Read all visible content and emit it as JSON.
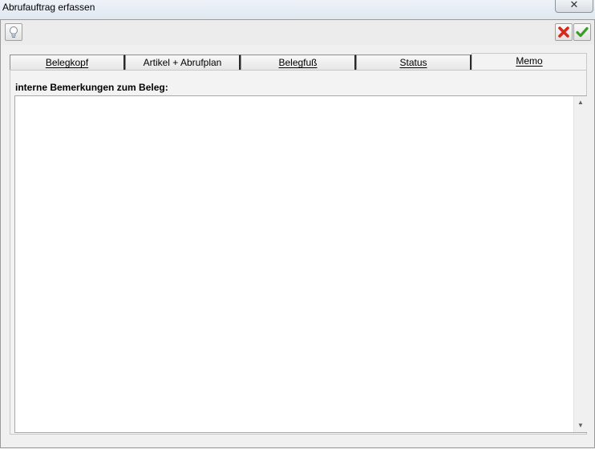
{
  "window": {
    "title": "Abrufauftrag erfassen",
    "close_symbol": "✕"
  },
  "toolbar": {
    "hint_icon": "lightbulb-icon",
    "cancel_icon": "red-x-icon",
    "ok_icon": "green-check-icon"
  },
  "tabs": [
    {
      "label": "Belegkopf",
      "active": false
    },
    {
      "label": "Artikel + Abrufplan",
      "active": false
    },
    {
      "label": "Belegfuß",
      "active": false
    },
    {
      "label": "Status",
      "active": false
    },
    {
      "label": "Memo",
      "active": true
    }
  ],
  "memo": {
    "label": "interne Bemerkungen zum Beleg:",
    "value": ""
  },
  "scrollbar": {
    "up_symbol": "▲",
    "down_symbol": "▼"
  },
  "colors": {
    "cancel_red": "#d8281e",
    "ok_green": "#3a9b2a"
  }
}
